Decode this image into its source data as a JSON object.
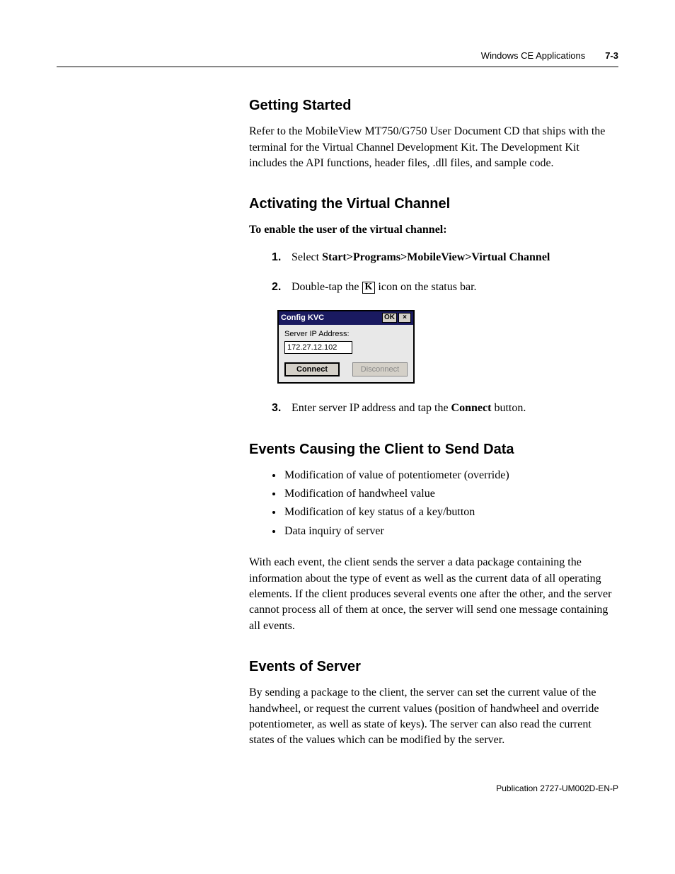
{
  "header": {
    "chapter_title": "Windows CE Applications",
    "page_number": "7-3"
  },
  "sections": {
    "getting_started": {
      "heading": "Getting Started",
      "body": "Refer to the MobileView MT750/G750 User Document CD that ships with the terminal for the Virtual Channel Development Kit. The Development Kit includes the API functions, header files, .dll files, and sample code."
    },
    "activating": {
      "heading": "Activating the Virtual Channel",
      "sub_bold": "To enable the user of the virtual channel:",
      "steps": {
        "n1": "1.",
        "t1_prefix": "Select ",
        "t1_bold": "Start>Programs>MobileView>Virtual Channel",
        "n2": "2.",
        "t2_prefix": "Double-tap the ",
        "t2_icon": "K",
        "t2_suffix": " icon on the status bar.",
        "n3": "3.",
        "t3_prefix": "Enter server IP address and tap the ",
        "t3_bold": "Connect",
        "t3_suffix": " button."
      }
    },
    "dialog": {
      "title": "Config KVC",
      "ok": "OK",
      "close": "×",
      "ip_label": "Server IP Address:",
      "ip_value": "172.27.12.102",
      "connect": "Connect",
      "disconnect": "Disconnect"
    },
    "events_client": {
      "heading": "Events Causing the Client to Send Data",
      "bullets": [
        "Modification of value of potentiometer (override)",
        "Modification of handwheel value",
        "Modification of key status of a key/button",
        "Data inquiry of server"
      ],
      "b0": "Modification of value of potentiometer (override)",
      "b1": "Modification of handwheel value",
      "b2": "Modification of key status of a key/button",
      "b3": "Data inquiry of server",
      "para": "With each event, the client sends the server a data package containing the information about the type of event as well as the current data of all operating elements. If the client produces several events one after the other, and the server cannot process all of them at once, the server will send one message containing all events."
    },
    "events_server": {
      "heading": "Events of Server",
      "body": "By sending a package to the client, the server can set the current value of the handwheel, or request the current values (position of handwheel and override potentiometer, as well as state of keys). The server can also read the current states of the values which can be modified by the server."
    }
  },
  "footer": {
    "publication": "Publication 2727-UM002D-EN-P"
  }
}
